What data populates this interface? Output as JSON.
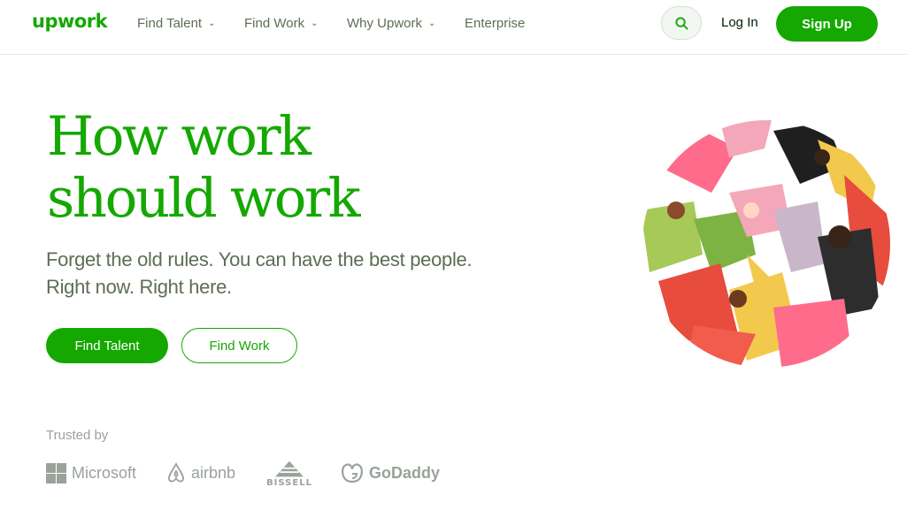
{
  "header": {
    "logo_text": "upwork",
    "nav": [
      {
        "label": "Find Talent",
        "has_dropdown": true
      },
      {
        "label": "Find Work",
        "has_dropdown": true
      },
      {
        "label": "Why Upwork",
        "has_dropdown": true
      },
      {
        "label": "Enterprise",
        "has_dropdown": false
      }
    ],
    "login_label": "Log In",
    "signup_label": "Sign Up"
  },
  "hero": {
    "headline_line1": "How work",
    "headline_line2": "should work",
    "subtitle_line1": "Forget the old rules. You can have the best people.",
    "subtitle_line2": "Right now. Right here.",
    "primary_button": "Find Talent",
    "secondary_button": "Find Work"
  },
  "trusted": {
    "label": "Trusted by",
    "brands": [
      "Microsoft",
      "airbnb",
      "BISSELL",
      "GoDaddy"
    ]
  },
  "colors": {
    "brand_green": "#14a800",
    "text_muted": "#5e6d55",
    "logo_gray": "#9aa29a"
  },
  "icons": [
    "search-icon",
    "chevron-down-icon",
    "microsoft-logo-icon",
    "airbnb-logo-icon",
    "bissell-logo-icon",
    "godaddy-logo-icon"
  ]
}
